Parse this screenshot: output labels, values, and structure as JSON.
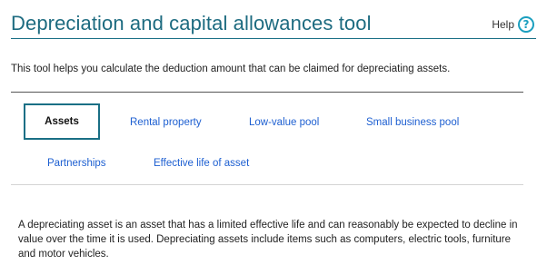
{
  "header": {
    "title": "Depreciation and capital allowances tool",
    "help_label": "Help",
    "help_icon": "question-circle-icon",
    "accent_color": "#1d6b80"
  },
  "intro_text": "This tool helps you calculate the deduction amount that can be claimed for depreciating assets.",
  "tabs": [
    {
      "label": "Assets",
      "active": true
    },
    {
      "label": "Rental property",
      "active": false
    },
    {
      "label": "Low-value pool",
      "active": false
    },
    {
      "label": "Small business pool",
      "active": false
    },
    {
      "label": "Partnerships",
      "active": false
    },
    {
      "label": "Effective life of asset",
      "active": false
    }
  ],
  "content": {
    "description": "A depreciating asset is an asset that has a limited effective life and can reasonably be expected to decline in value over the time it is used. Depreciating assets include items such as computers, electric tools, furniture and motor vehicles."
  }
}
